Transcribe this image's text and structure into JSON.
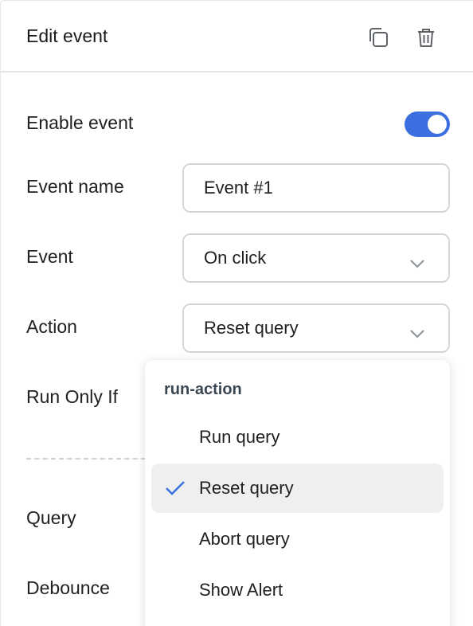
{
  "header": {
    "title": "Edit event",
    "copy_icon": "copy-icon",
    "trash_icon": "trash-icon"
  },
  "form": {
    "enable_event_label": "Enable event",
    "enable_event_on": true,
    "event_name_label": "Event name",
    "event_name_value": "Event #1",
    "event_label": "Event",
    "event_value": "On click",
    "action_label": "Action",
    "action_value": "Reset query",
    "run_only_if_label": "Run Only If",
    "query_label": "Query",
    "debounce_label": "Debounce"
  },
  "dropdown": {
    "group_label": "run-action",
    "items": [
      {
        "label": "Run query",
        "selected": false
      },
      {
        "label": "Reset query",
        "selected": true
      },
      {
        "label": "Abort query",
        "selected": false
      },
      {
        "label": "Show Alert",
        "selected": false
      }
    ]
  },
  "colors": {
    "accent": "#3b6fe0",
    "selected_bg": "#efefef",
    "border": "#d6d6d6"
  }
}
